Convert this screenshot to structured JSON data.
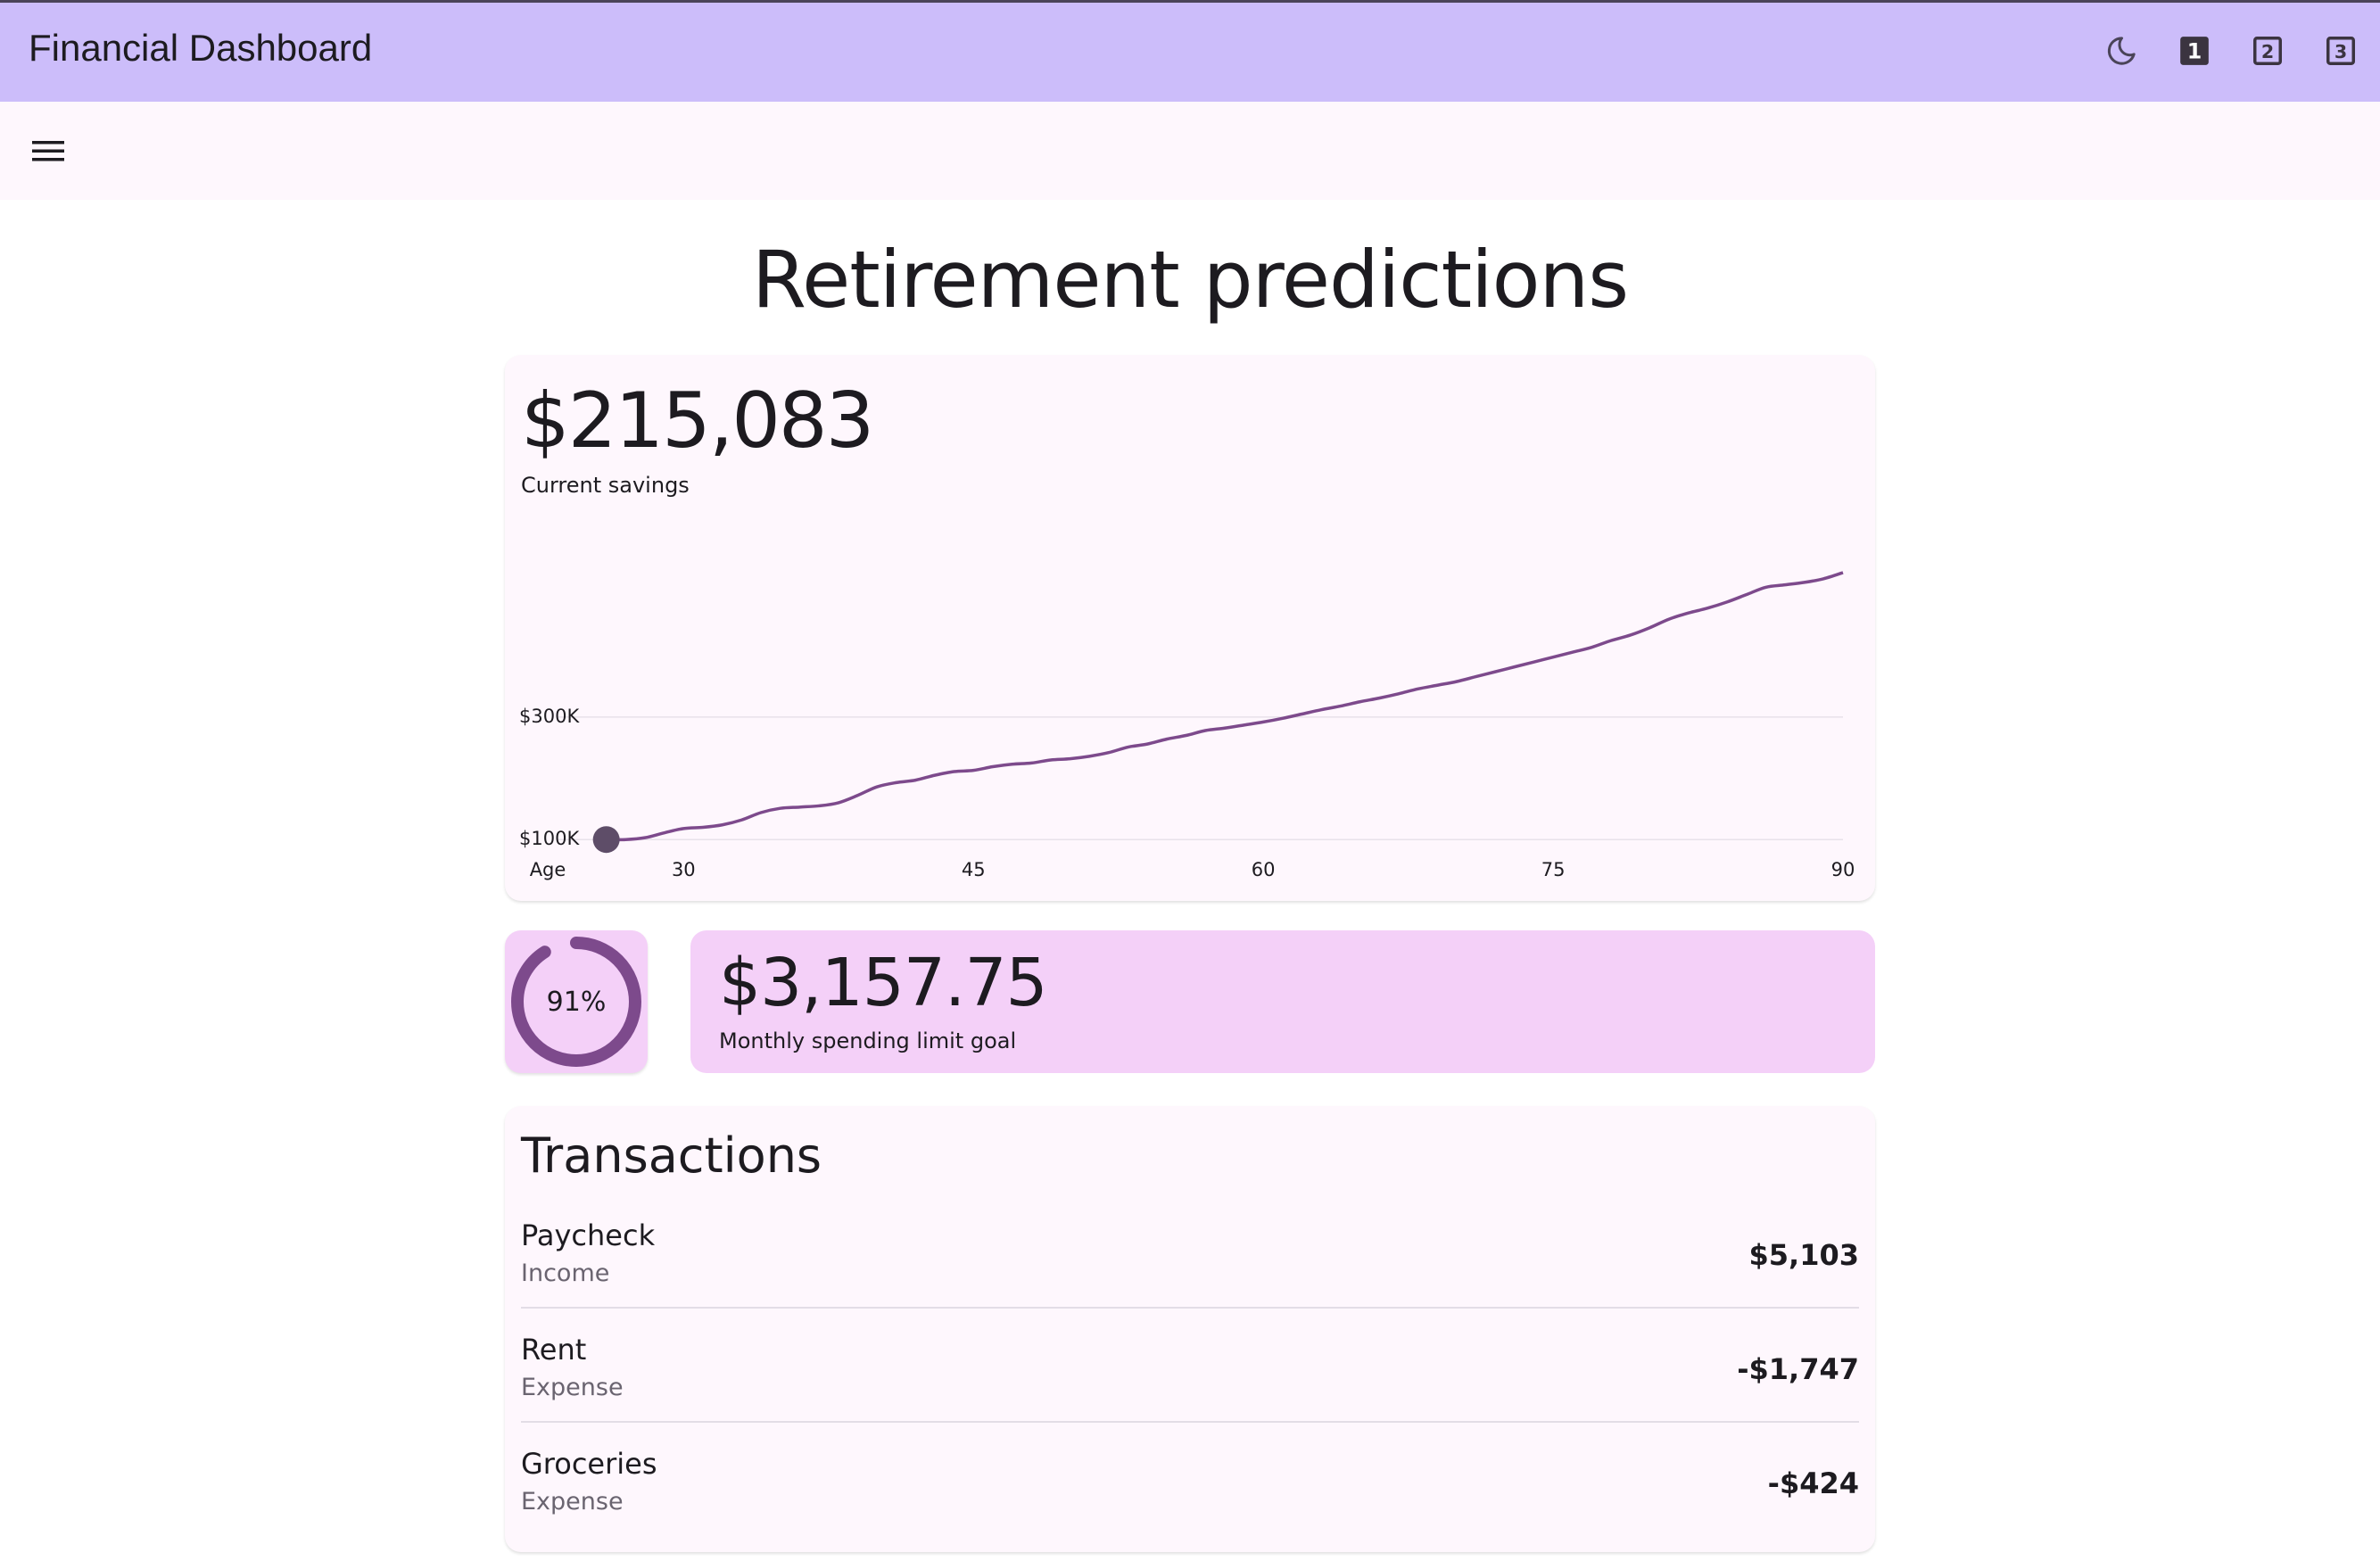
{
  "app": {
    "title": "Financial Dashboard"
  },
  "appbar_actions": [
    {
      "icon": "moon-icon"
    },
    {
      "icon": "looks-one-icon",
      "label": "1"
    },
    {
      "icon": "looks-two-icon",
      "label": "2"
    },
    {
      "icon": "looks-3-icon",
      "label": "3"
    }
  ],
  "toolbar": {
    "menu_icon": "menu-icon"
  },
  "page": {
    "title": "Retirement predictions"
  },
  "savings": {
    "amount": "$215,083",
    "label": "Current savings"
  },
  "chart_data": {
    "type": "line",
    "title": "",
    "xlabel": "Age",
    "ylabel": "",
    "x_ticks": [
      "30",
      "45",
      "60",
      "75",
      "90"
    ],
    "y_ticks": [
      "$100K",
      "$300K"
    ],
    "x": [
      26,
      27,
      28,
      29,
      30,
      31,
      32,
      33,
      34,
      35,
      36,
      37,
      38,
      39,
      40,
      41,
      42,
      43,
      44,
      45,
      46,
      47,
      48,
      49,
      50,
      51,
      52,
      53,
      54,
      55,
      56,
      57,
      58,
      59,
      60,
      61,
      62,
      63,
      64,
      65,
      66,
      67,
      68,
      69,
      70,
      71,
      72,
      73,
      74,
      75,
      76,
      77,
      78,
      79,
      80,
      81,
      82,
      83,
      84,
      85,
      86,
      87,
      88,
      89,
      90
    ],
    "series": [
      {
        "values": [
          100,
          100,
          103,
          111,
          118,
          120,
          124,
          132,
          144,
          151,
          153,
          155,
          160,
          172,
          186,
          193,
          197,
          205,
          211,
          213,
          219,
          223,
          225,
          230,
          232,
          236,
          242,
          251,
          256,
          264,
          270,
          278,
          282,
          287,
          292,
          298,
          305,
          312,
          318,
          325,
          331,
          338,
          346,
          352,
          358,
          366,
          374,
          382,
          390,
          398,
          406,
          414,
          425,
          434,
          446,
          460,
          470,
          478,
          488,
          500,
          512,
          516,
          520,
          526,
          536
        ]
      }
    ],
    "xlim": [
      25,
      90
    ],
    "ylim": [
      93,
      600
    ],
    "grid": true,
    "line_color": "#7d4a8c",
    "marker_color": "#5e4d68"
  },
  "spending": {
    "progress_percent": 91,
    "progress_label": "91%",
    "amount": "$3,157.75",
    "label": "Monthly spending limit goal",
    "ring_color": "#7d4a8c",
    "card_color": "#f4d0f8"
  },
  "transactions": {
    "title": "Transactions",
    "items": [
      {
        "name": "Paycheck",
        "type": "Income",
        "amount": "$5,103"
      },
      {
        "name": "Rent",
        "type": "Expense",
        "amount": "-$1,747"
      },
      {
        "name": "Groceries",
        "type": "Expense",
        "amount": "-$424"
      }
    ]
  },
  "colors": {
    "appbar": "#ccbdfa",
    "surface": "#fef7fd",
    "accent": "#7d4a8c"
  }
}
